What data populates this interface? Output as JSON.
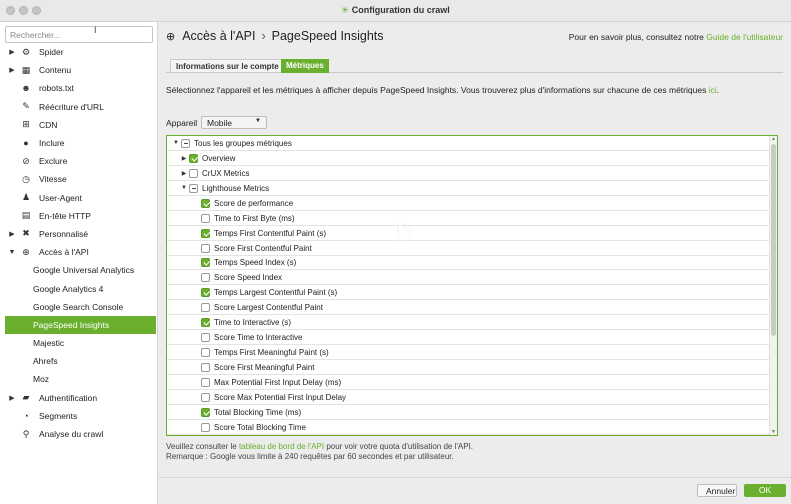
{
  "window": {
    "title": "Configuration du crawl"
  },
  "sidebar": {
    "search_placeholder": "Rechercher...",
    "items": [
      {
        "label": "Spider",
        "icon": "gear-icon",
        "glyph": "⚙",
        "arrow": "▶",
        "sub": false
      },
      {
        "label": "Contenu",
        "icon": "document-icon",
        "glyph": "▦",
        "arrow": "▶",
        "sub": false
      },
      {
        "label": "robots.txt",
        "icon": "robot-icon",
        "glyph": "☻",
        "arrow": "",
        "sub": false
      },
      {
        "label": "Réécriture d'URL",
        "icon": "edit-icon",
        "glyph": "✎",
        "arrow": "",
        "sub": false
      },
      {
        "label": "CDN",
        "icon": "cdn-icon",
        "glyph": "⊞",
        "arrow": "",
        "sub": false
      },
      {
        "label": "Inclure",
        "icon": "include-icon",
        "glyph": "●",
        "arrow": "",
        "sub": false
      },
      {
        "label": "Exclure",
        "icon": "exclude-icon",
        "glyph": "⊘",
        "arrow": "",
        "sub": false
      },
      {
        "label": "Vitesse",
        "icon": "speed-icon",
        "glyph": "◷",
        "arrow": "",
        "sub": false
      },
      {
        "label": "User-Agent",
        "icon": "user-icon",
        "glyph": "♟",
        "arrow": "",
        "sub": false
      },
      {
        "label": "En-tête HTTP",
        "icon": "header-icon",
        "glyph": "▤",
        "arrow": "",
        "sub": false
      },
      {
        "label": "Personnalisé",
        "icon": "tools-icon",
        "glyph": "✖",
        "arrow": "▶",
        "sub": false
      },
      {
        "label": "Accès à l'API",
        "icon": "globe-icon",
        "glyph": "⊕",
        "arrow": "▼",
        "sub": false
      },
      {
        "label": "Google Universal Analytics",
        "sub": true
      },
      {
        "label": "Google Analytics 4",
        "sub": true
      },
      {
        "label": "Google Search Console",
        "sub": true
      },
      {
        "label": "PageSpeed Insights",
        "sub": true,
        "selected": true
      },
      {
        "label": "Majestic",
        "sub": true
      },
      {
        "label": "Ahrefs",
        "sub": true
      },
      {
        "label": "Moz",
        "sub": true
      },
      {
        "label": "Authentification",
        "icon": "lock-icon",
        "glyph": "▰",
        "arrow": "▶",
        "sub": false
      },
      {
        "label": "Segments",
        "icon": "segments-icon",
        "glyph": "◔",
        "arrow": "",
        "sub": false
      },
      {
        "label": "Analyse du crawl",
        "icon": "search-icon",
        "glyph": "⚲",
        "arrow": "",
        "sub": false
      }
    ]
  },
  "header": {
    "breadcrumb_root": "Accès à l'API",
    "breadcrumb_sep": "›",
    "breadcrumb_current": "PageSpeed Insights",
    "more_prefix": "Pour en savoir plus, consultez notre ",
    "more_link": "Guide de l'utilisateur"
  },
  "tabs": [
    {
      "label": "Informations sur le compte",
      "active": false
    },
    {
      "label": "Métriques",
      "active": true
    }
  ],
  "description": {
    "text": "Sélectionnez l'appareil et les métriques à afficher depuis PageSpeed Insights. Vous trouverez plus d'informations sur chacune de ces métriques ",
    "link": "ici",
    "end": "."
  },
  "device": {
    "label": "Appareil",
    "value": "Mobile"
  },
  "metrics": [
    {
      "label": "Tous les groupes métriques",
      "level": 0,
      "expander": "▼",
      "state": "partial"
    },
    {
      "label": "Overview",
      "level": 1,
      "expander": "▶",
      "state": "checked"
    },
    {
      "label": "CrUX Metrics",
      "level": 1,
      "expander": "▶",
      "state": "unchecked"
    },
    {
      "label": "Lighthouse Metrics",
      "level": 1,
      "expander": "▼",
      "state": "partial"
    },
    {
      "label": "Score de performance",
      "level": 2,
      "state": "checked"
    },
    {
      "label": "Time to First Byte (ms)",
      "level": 2,
      "state": "unchecked"
    },
    {
      "label": "Temps First Contentful Paint (s)",
      "level": 2,
      "state": "checked"
    },
    {
      "label": "Score First Contentful Paint",
      "level": 2,
      "state": "unchecked"
    },
    {
      "label": "Temps Speed Index (s)",
      "level": 2,
      "state": "checked"
    },
    {
      "label": "Score Speed Index",
      "level": 2,
      "state": "unchecked"
    },
    {
      "label": "Temps Largest Contentful Paint (s)",
      "level": 2,
      "state": "checked"
    },
    {
      "label": "Score Largest Contentful Paint",
      "level": 2,
      "state": "unchecked"
    },
    {
      "label": "Time to Interactive (s)",
      "level": 2,
      "state": "checked"
    },
    {
      "label": "Score Time to Interactive",
      "level": 2,
      "state": "unchecked"
    },
    {
      "label": "Temps First Meaningful Paint (s)",
      "level": 2,
      "state": "unchecked"
    },
    {
      "label": "Score First Meaningful Paint",
      "level": 2,
      "state": "unchecked"
    },
    {
      "label": "Max Potential First Input Delay (ms)",
      "level": 2,
      "state": "unchecked"
    },
    {
      "label": "Score Max Potential First Input Delay",
      "level": 2,
      "state": "unchecked"
    },
    {
      "label": "Total Blocking Time (ms)",
      "level": 2,
      "state": "checked"
    },
    {
      "label": "Score Total Blocking Time",
      "level": 2,
      "state": "unchecked"
    }
  ],
  "notes": {
    "line1_prefix": "Veuillez consulter le ",
    "line1_link": "tableau de bord de l'API",
    "line1_suffix": " pour voir votre quota d'utilisation de l'API.",
    "line2": "Remarque : Google vous limite à 240 requêtes par 60 secondes et par utilisateur."
  },
  "footer": {
    "cancel": "Annuler",
    "ok": "OK"
  },
  "colors": {
    "accent": "#6aaf2d"
  }
}
